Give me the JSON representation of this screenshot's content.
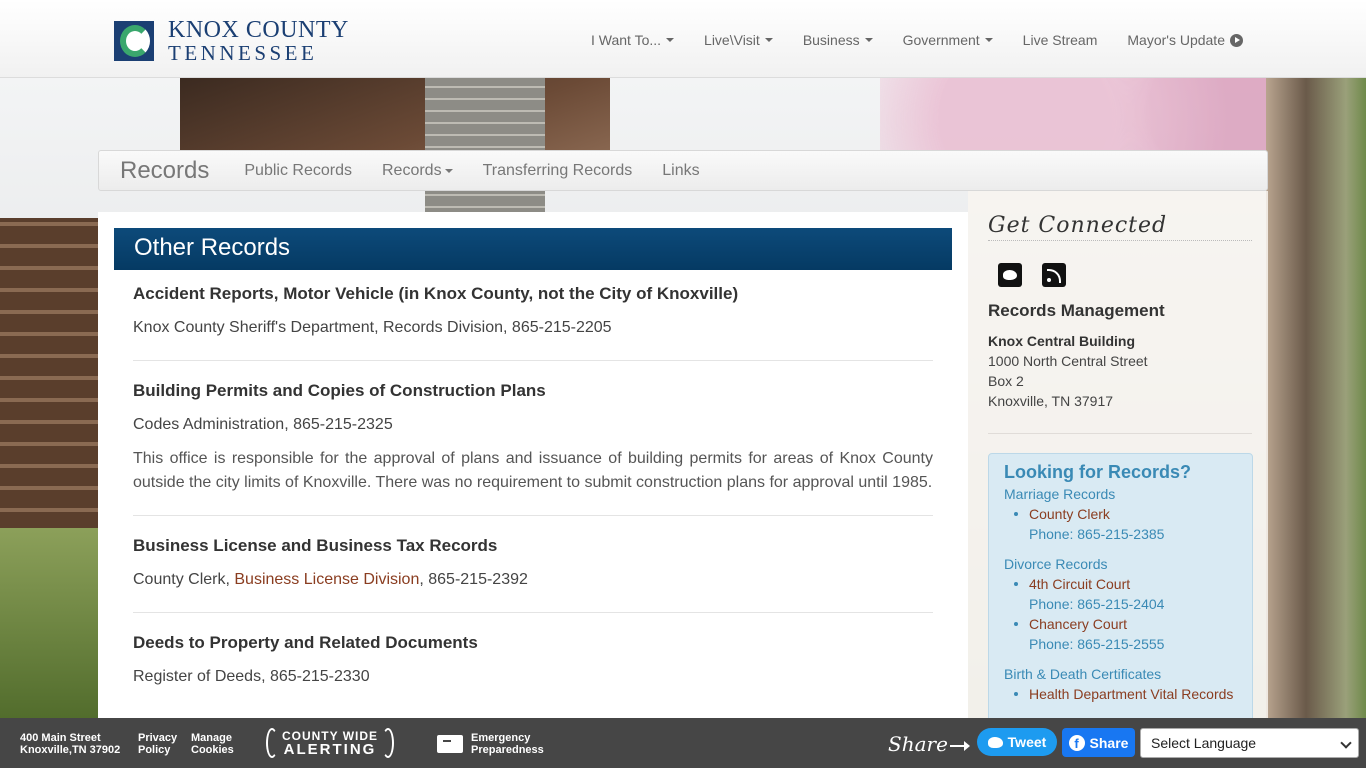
{
  "header": {
    "logo_line1": "KNOX COUNTY",
    "logo_line2": "TENNESSEE",
    "nav": [
      {
        "label": "I Want To..."
      },
      {
        "label": "Live\\Visit"
      },
      {
        "label": "Business"
      },
      {
        "label": "Government"
      },
      {
        "label": "Live Stream"
      },
      {
        "label": "Mayor's Update"
      }
    ]
  },
  "subnav": {
    "brand": "Records",
    "links": [
      {
        "label": "Public Records"
      },
      {
        "label": "Records"
      },
      {
        "label": "Transferring Records"
      },
      {
        "label": "Links"
      }
    ]
  },
  "main": {
    "heading": "Other Records",
    "records": [
      {
        "title": "Accident Reports, Motor Vehicle (in Knox County, not the City of Knoxville)",
        "line": "Knox County Sheriff's Department, Records Division, 865-215-2205"
      },
      {
        "title": "Building Permits and Copies of Construction Plans",
        "line": "Codes Administration, 865-215-2325",
        "desc": "This office is responsible for the approval of plans and issuance of building permits for areas of Knox County outside the city limits of Knoxville. There was no requirement to submit construction plans for approval until 1985."
      },
      {
        "title": "Business License and Business Tax Records",
        "line_prefix": "County Clerk, ",
        "line_link": "Business License Division",
        "line_suffix": ", 865-215-2392"
      },
      {
        "title": "Deeds to Property and Related Documents",
        "line": "Register of Deeds, 865-215-2330"
      }
    ]
  },
  "sidebar": {
    "get_connected": "Get Connected",
    "dept_title": "Records Management",
    "building": "Knox Central Building",
    "street": "1000 North Central Street",
    "box": "Box 2",
    "city": "Knoxville, TN 37917",
    "looking": {
      "title": "Looking for Records?",
      "groups": [
        {
          "category": "Marriage Records",
          "items": [
            {
              "name": "County Clerk",
              "phone": "Phone: 865-215-2385"
            }
          ]
        },
        {
          "category": "Divorce Records",
          "items": [
            {
              "name": "4th Circuit Court",
              "phone": "Phone: 865-215-2404"
            },
            {
              "name": "Chancery Court",
              "phone": "Phone: 865-215-2555"
            }
          ]
        },
        {
          "category": "Birth & Death Certificates",
          "items": [
            {
              "name": "Health Department Vital Records",
              "phone": ""
            }
          ]
        }
      ]
    }
  },
  "footer": {
    "address1": "400 Main Street",
    "address2": "Knoxville,TN 37902",
    "privacy1": "Privacy",
    "privacy2": "Policy",
    "cookies1": "Manage",
    "cookies2": "Cookies",
    "alert1": "COUNTY WIDE",
    "alert2": "ALERTING",
    "emergency1": "Emergency",
    "emergency2": "Preparedness",
    "share": "Share",
    "tweet": "Tweet",
    "fb_share": "Share",
    "language": "Select Language"
  },
  "colors": {
    "heading_bar": "#053a63",
    "link": "#8a3d20",
    "sidebar_accent": "#3a8ab5",
    "footer": "#464646"
  }
}
